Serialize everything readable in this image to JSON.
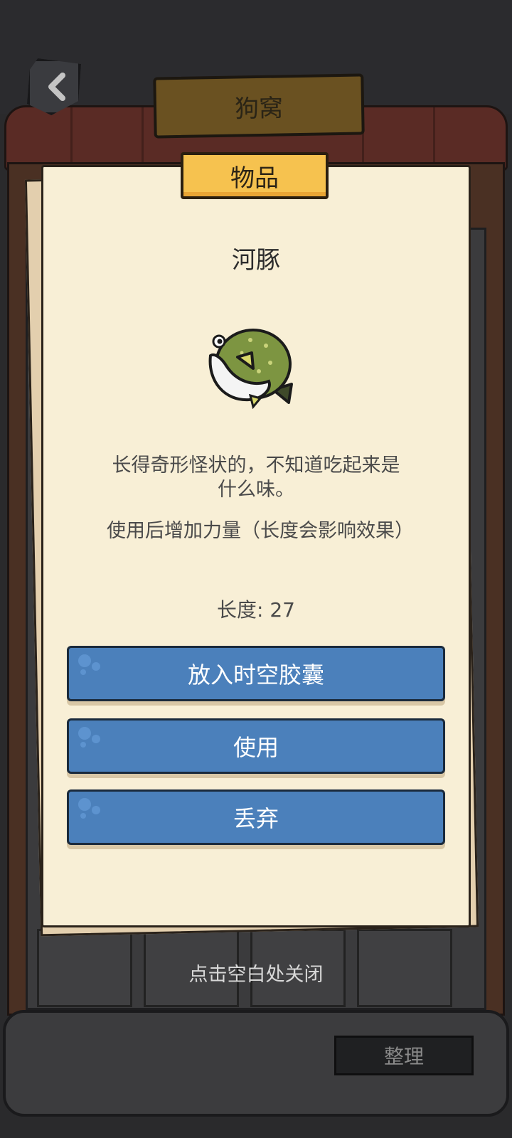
{
  "header": {
    "back_icon": "chevron-left-icon",
    "title": "狗窝"
  },
  "panel": {
    "category": "物品",
    "item_name": "河豚",
    "item_icon": "pufferfish-icon",
    "description": "长得奇形怪状的，不知道吃起来是什么味。",
    "effect": "使用后增加力量（长度会影响效果）",
    "length_text": "长度: 27",
    "buttons": {
      "capsule": "放入时空胶囊",
      "use": "使用",
      "discard": "丢弃"
    }
  },
  "close_hint": "点击空白处关闭",
  "sort_button": "整理",
  "colors": {
    "button_blue": "#4b80bb",
    "banner_yellow": "#f6c24f",
    "paper": "#f8efd6"
  }
}
